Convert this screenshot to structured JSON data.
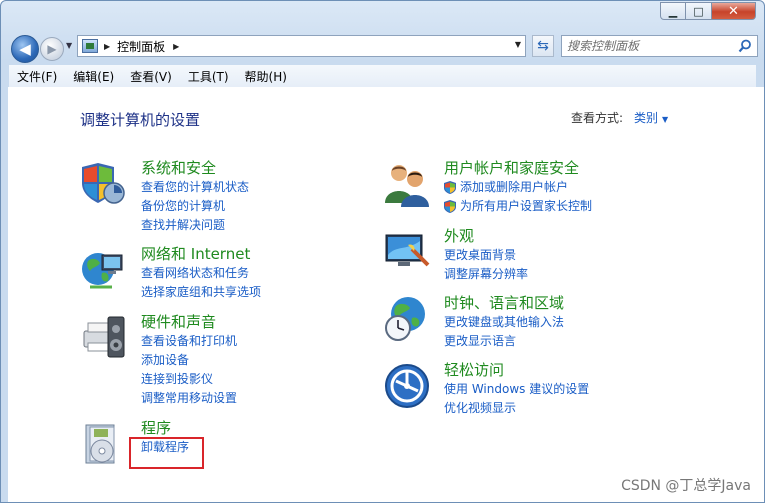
{
  "window": {
    "min_label": "▁",
    "max_label": "□",
    "close_label": "✕"
  },
  "nav": {
    "address_text": "控制面板",
    "search_placeholder": "搜索控制面板"
  },
  "menu": [
    "文件(F)",
    "编辑(E)",
    "查看(V)",
    "工具(T)",
    "帮助(H)"
  ],
  "page": {
    "title": "调整计算机的设置",
    "view_by_label": "查看方式:",
    "view_by_value": "类别"
  },
  "categories": [
    {
      "title": "系统和安全",
      "icon": "system-security-icon",
      "links": [
        "查看您的计算机状态",
        "备份您的计算机",
        "查找并解决问题"
      ]
    },
    {
      "title": "网络和 Internet",
      "icon": "network-icon",
      "links": [
        "查看网络状态和任务",
        "选择家庭组和共享选项"
      ]
    },
    {
      "title": "硬件和声音",
      "icon": "hardware-sound-icon",
      "links": [
        "查看设备和打印机",
        "添加设备",
        "连接到投影仪",
        "调整常用移动设置"
      ]
    },
    {
      "title": "程序",
      "icon": "programs-icon",
      "links": [
        "卸载程序"
      ]
    },
    {
      "title": "用户帐户和家庭安全",
      "icon": "user-accounts-icon",
      "links": [
        "添加或删除用户帐户",
        "为所有用户设置家长控制"
      ]
    },
    {
      "title": "外观",
      "icon": "appearance-icon",
      "links": [
        "更改桌面背景",
        "调整屏幕分辨率"
      ]
    },
    {
      "title": "时钟、语言和区域",
      "icon": "clock-language-icon",
      "links": [
        "更改键盘或其他输入法",
        "更改显示语言"
      ]
    },
    {
      "title": "轻松访问",
      "icon": "ease-of-access-icon",
      "links": [
        "使用 Windows 建议的设置",
        "优化视频显示"
      ]
    }
  ],
  "watermark": "CSDN @丁总学Java",
  "colors": {
    "heading": "#1f8a1f",
    "link": "#1a5dc6",
    "title": "#1e3287",
    "highlight": "#d9252a"
  }
}
